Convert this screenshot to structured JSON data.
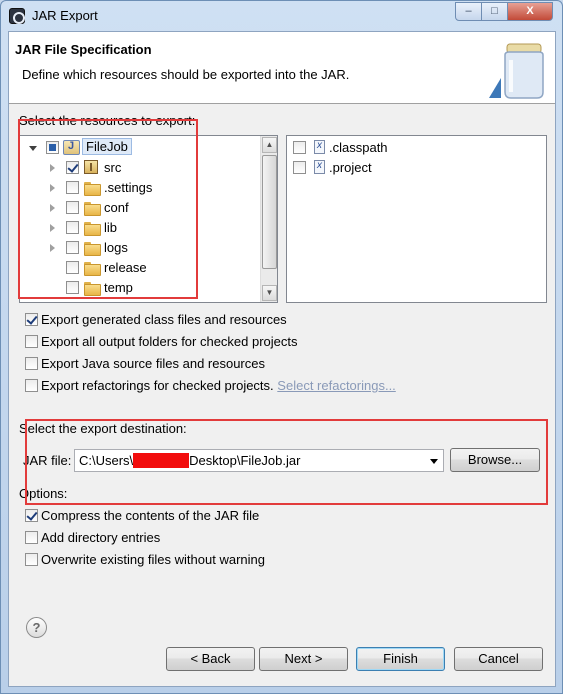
{
  "window": {
    "title": "JAR Export",
    "controls": {
      "minimize": "‒",
      "maximize": "□",
      "close": "X"
    }
  },
  "header": {
    "title": "JAR File Specification",
    "description": "Define which resources should be exported into the JAR."
  },
  "resources": {
    "label": "Select the resources to export:",
    "tree": [
      {
        "label": "FileJob",
        "checked": "partial",
        "expanded": true,
        "icon": "java-project-icon"
      },
      {
        "label": "src",
        "checked": "checked",
        "expanded": false,
        "icon": "package-folder-icon"
      },
      {
        "label": ".settings",
        "checked": "unchecked",
        "expanded": false,
        "icon": "folder-icon"
      },
      {
        "label": "conf",
        "checked": "unchecked",
        "expanded": false,
        "icon": "folder-icon"
      },
      {
        "label": "lib",
        "checked": "unchecked",
        "expanded": false,
        "icon": "folder-icon"
      },
      {
        "label": "logs",
        "checked": "unchecked",
        "expanded": false,
        "icon": "folder-icon"
      },
      {
        "label": "release",
        "checked": "unchecked",
        "icon": "folder-icon"
      },
      {
        "label": "temp",
        "checked": "unchecked",
        "icon": "folder-icon"
      }
    ],
    "files": [
      {
        "label": ".classpath",
        "checked": false,
        "icon": "xml-file-icon"
      },
      {
        "label": ".project",
        "checked": false,
        "icon": "xml-file-icon"
      }
    ]
  },
  "export_options": [
    {
      "label": "Export generated class files and resources",
      "checked": true
    },
    {
      "label": "Export all output folders for checked projects",
      "checked": false
    },
    {
      "label": "Export Java source files and resources",
      "checked": false
    },
    {
      "label": "Export refactorings for checked projects.",
      "checked": false,
      "link": "Select refactorings..."
    }
  ],
  "destination": {
    "label": "Select the export destination:",
    "jar_file_label": "JAR file:",
    "path_prefix": "C:\\Users\\",
    "path_suffix": "Desktop\\FileJob.jar",
    "browse_label": "Browse..."
  },
  "options": {
    "label": "Options:",
    "items": [
      {
        "label": "Compress the contents of the JAR file",
        "checked": true
      },
      {
        "label": "Add directory entries",
        "checked": false
      },
      {
        "label": "Overwrite existing files without warning",
        "checked": false
      }
    ]
  },
  "buttons": {
    "help": "?",
    "back": "< Back",
    "next": "Next >",
    "finish": "Finish",
    "cancel": "Cancel"
  },
  "colors": {
    "annotation": "#e23b3b",
    "redaction": "#f20d0d",
    "link": "#8a9ab8"
  }
}
